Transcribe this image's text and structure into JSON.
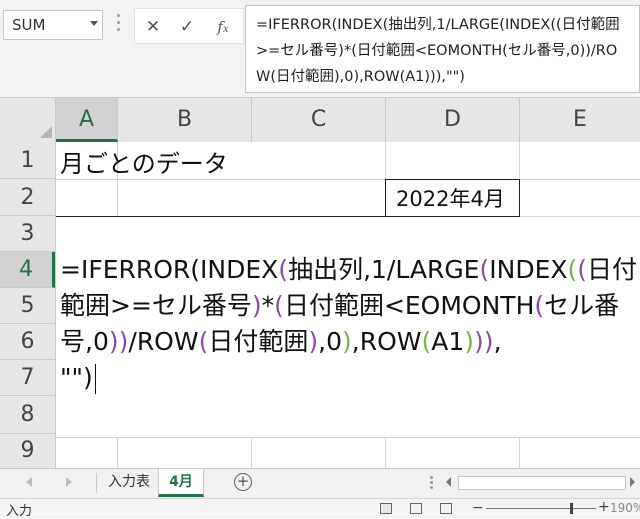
{
  "namebox": {
    "value": "SUM"
  },
  "formula_bar": {
    "icons": [
      "close-icon",
      "check-icon",
      "fx-icon"
    ],
    "formula": "=IFERROR(INDEX(抽出列,1/LARGE(INDEX((日付範囲>=セル番号)*(日付範囲<EOMONTH(セル番号,0))/ROW(日付範囲),0),ROW(A1))),\"\")"
  },
  "columns": [
    "A",
    "B",
    "C",
    "D",
    "E"
  ],
  "rows": [
    "1",
    "2",
    "3",
    "4",
    "5",
    "6",
    "7",
    "8",
    "9"
  ],
  "active_column": "A",
  "active_row": "4",
  "cells": {
    "A1": "月ごとのデータ",
    "D2": "2022年4月"
  },
  "editor_parts": [
    {
      "text": "=IFERROR(INDEX",
      "c": 0
    },
    {
      "text": "(",
      "c": 1
    },
    {
      "text": "抽出列,1/LARGE",
      "c": 0
    },
    {
      "text": "(",
      "c": 1
    },
    {
      "text": "INDEX",
      "c": 0
    },
    {
      "text": "(",
      "c": 2
    },
    {
      "text": "(",
      "c": 3
    },
    {
      "text": "日付範囲>=セル番号",
      "c": 0
    },
    {
      "text": ")",
      "c": 3
    },
    {
      "text": "*",
      "c": 0
    },
    {
      "text": "(",
      "c": 3
    },
    {
      "text": "日付範囲<EOMONTH",
      "c": 0
    },
    {
      "text": "(",
      "c": 1
    },
    {
      "text": "セル番号,0",
      "c": 0
    },
    {
      "text": ")",
      "c": 1
    },
    {
      "text": ")",
      "c": 3
    },
    {
      "text": "/ROW",
      "c": 0
    },
    {
      "text": "(",
      "c": 3
    },
    {
      "text": "日付範囲",
      "c": 0
    },
    {
      "text": ")",
      "c": 3
    },
    {
      "text": ",0",
      "c": 0
    },
    {
      "text": ")",
      "c": 2
    },
    {
      "text": ",ROW",
      "c": 0
    },
    {
      "text": "(",
      "c": 2
    },
    {
      "text": "A1",
      "c": 0
    },
    {
      "text": ")",
      "c": 2
    },
    {
      "text": ")",
      "c": 1
    },
    {
      "text": ")",
      "c": 1
    },
    {
      "text": ",\n\"\")",
      "c": 0
    }
  ],
  "sheet_tabs": [
    {
      "label": "入力表",
      "active": false
    },
    {
      "label": "4月",
      "active": true
    }
  ],
  "status": {
    "mode": "入力",
    "zoom": "190%"
  },
  "colors": {
    "accent": "#217346",
    "paren_purple": "#8a4b9c",
    "paren_green": "#7ab04b"
  }
}
